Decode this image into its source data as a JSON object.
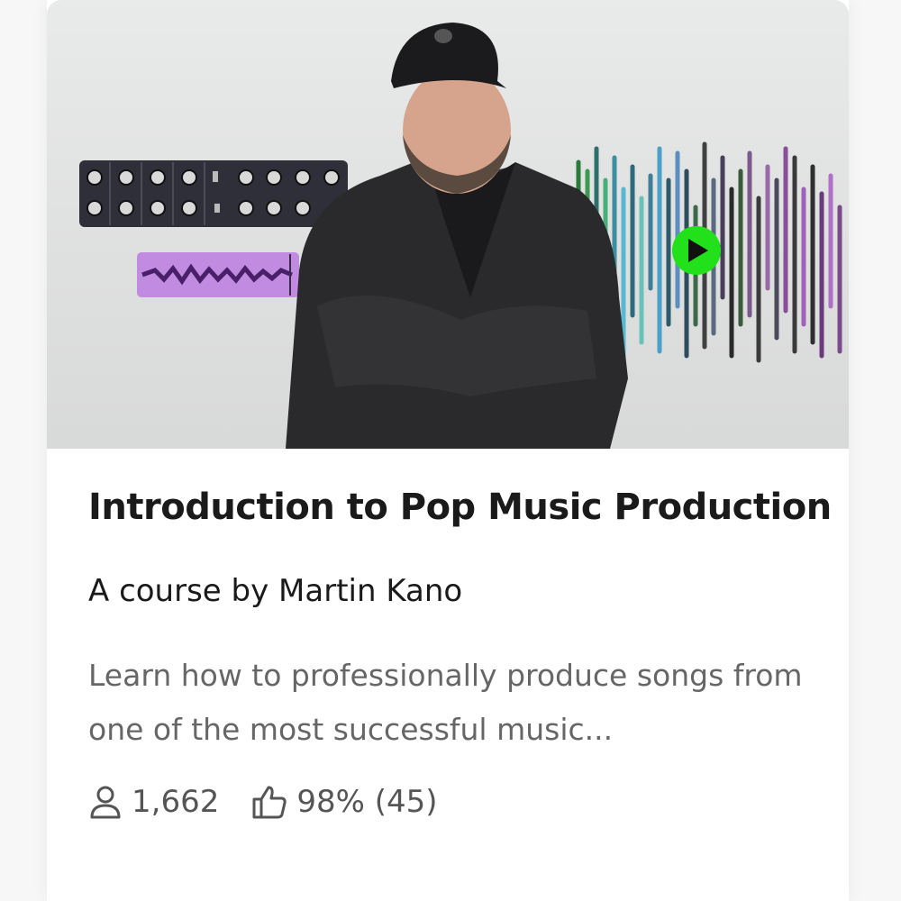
{
  "course": {
    "title": "Introduction to Pop Music Production",
    "author": "A course by Martin Kano",
    "description": "Learn how to professionally produce songs from one of the most successful music...",
    "students": "1,662",
    "rating": "98% (45)"
  },
  "icons": {
    "students": "user-icon",
    "rating": "thumbs-up-icon",
    "play": "play-icon"
  },
  "colors": {
    "title": "#1a1a1a",
    "description": "#666666",
    "play_accent": "#22e01a",
    "waveform_purple": "#b77ad9"
  }
}
